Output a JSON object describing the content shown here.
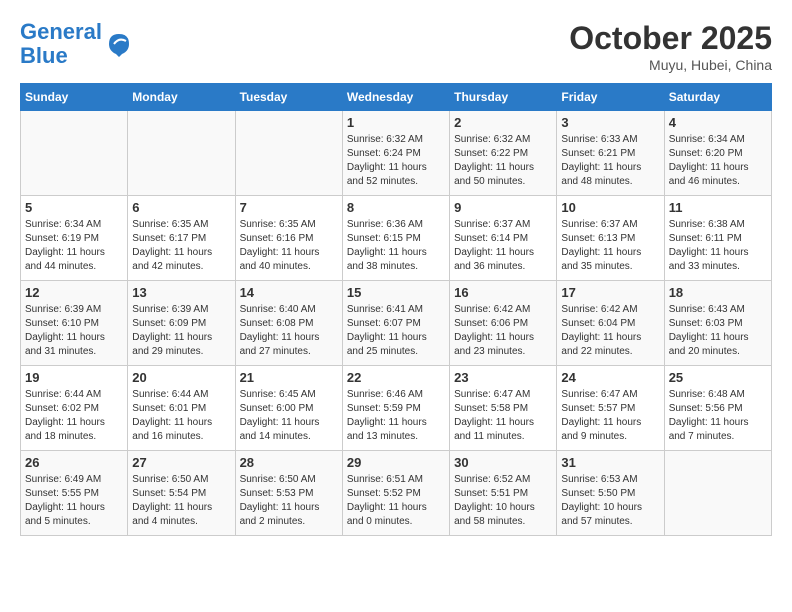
{
  "header": {
    "logo_line1": "General",
    "logo_line2": "Blue",
    "month": "October 2025",
    "location": "Muyu, Hubei, China"
  },
  "days_of_week": [
    "Sunday",
    "Monday",
    "Tuesday",
    "Wednesday",
    "Thursday",
    "Friday",
    "Saturday"
  ],
  "weeks": [
    [
      {
        "day": "",
        "info": ""
      },
      {
        "day": "",
        "info": ""
      },
      {
        "day": "",
        "info": ""
      },
      {
        "day": "1",
        "info": "Sunrise: 6:32 AM\nSunset: 6:24 PM\nDaylight: 11 hours\nand 52 minutes."
      },
      {
        "day": "2",
        "info": "Sunrise: 6:32 AM\nSunset: 6:22 PM\nDaylight: 11 hours\nand 50 minutes."
      },
      {
        "day": "3",
        "info": "Sunrise: 6:33 AM\nSunset: 6:21 PM\nDaylight: 11 hours\nand 48 minutes."
      },
      {
        "day": "4",
        "info": "Sunrise: 6:34 AM\nSunset: 6:20 PM\nDaylight: 11 hours\nand 46 minutes."
      }
    ],
    [
      {
        "day": "5",
        "info": "Sunrise: 6:34 AM\nSunset: 6:19 PM\nDaylight: 11 hours\nand 44 minutes."
      },
      {
        "day": "6",
        "info": "Sunrise: 6:35 AM\nSunset: 6:17 PM\nDaylight: 11 hours\nand 42 minutes."
      },
      {
        "day": "7",
        "info": "Sunrise: 6:35 AM\nSunset: 6:16 PM\nDaylight: 11 hours\nand 40 minutes."
      },
      {
        "day": "8",
        "info": "Sunrise: 6:36 AM\nSunset: 6:15 PM\nDaylight: 11 hours\nand 38 minutes."
      },
      {
        "day": "9",
        "info": "Sunrise: 6:37 AM\nSunset: 6:14 PM\nDaylight: 11 hours\nand 36 minutes."
      },
      {
        "day": "10",
        "info": "Sunrise: 6:37 AM\nSunset: 6:13 PM\nDaylight: 11 hours\nand 35 minutes."
      },
      {
        "day": "11",
        "info": "Sunrise: 6:38 AM\nSunset: 6:11 PM\nDaylight: 11 hours\nand 33 minutes."
      }
    ],
    [
      {
        "day": "12",
        "info": "Sunrise: 6:39 AM\nSunset: 6:10 PM\nDaylight: 11 hours\nand 31 minutes."
      },
      {
        "day": "13",
        "info": "Sunrise: 6:39 AM\nSunset: 6:09 PM\nDaylight: 11 hours\nand 29 minutes."
      },
      {
        "day": "14",
        "info": "Sunrise: 6:40 AM\nSunset: 6:08 PM\nDaylight: 11 hours\nand 27 minutes."
      },
      {
        "day": "15",
        "info": "Sunrise: 6:41 AM\nSunset: 6:07 PM\nDaylight: 11 hours\nand 25 minutes."
      },
      {
        "day": "16",
        "info": "Sunrise: 6:42 AM\nSunset: 6:06 PM\nDaylight: 11 hours\nand 23 minutes."
      },
      {
        "day": "17",
        "info": "Sunrise: 6:42 AM\nSunset: 6:04 PM\nDaylight: 11 hours\nand 22 minutes."
      },
      {
        "day": "18",
        "info": "Sunrise: 6:43 AM\nSunset: 6:03 PM\nDaylight: 11 hours\nand 20 minutes."
      }
    ],
    [
      {
        "day": "19",
        "info": "Sunrise: 6:44 AM\nSunset: 6:02 PM\nDaylight: 11 hours\nand 18 minutes."
      },
      {
        "day": "20",
        "info": "Sunrise: 6:44 AM\nSunset: 6:01 PM\nDaylight: 11 hours\nand 16 minutes."
      },
      {
        "day": "21",
        "info": "Sunrise: 6:45 AM\nSunset: 6:00 PM\nDaylight: 11 hours\nand 14 minutes."
      },
      {
        "day": "22",
        "info": "Sunrise: 6:46 AM\nSunset: 5:59 PM\nDaylight: 11 hours\nand 13 minutes."
      },
      {
        "day": "23",
        "info": "Sunrise: 6:47 AM\nSunset: 5:58 PM\nDaylight: 11 hours\nand 11 minutes."
      },
      {
        "day": "24",
        "info": "Sunrise: 6:47 AM\nSunset: 5:57 PM\nDaylight: 11 hours\nand 9 minutes."
      },
      {
        "day": "25",
        "info": "Sunrise: 6:48 AM\nSunset: 5:56 PM\nDaylight: 11 hours\nand 7 minutes."
      }
    ],
    [
      {
        "day": "26",
        "info": "Sunrise: 6:49 AM\nSunset: 5:55 PM\nDaylight: 11 hours\nand 5 minutes."
      },
      {
        "day": "27",
        "info": "Sunrise: 6:50 AM\nSunset: 5:54 PM\nDaylight: 11 hours\nand 4 minutes."
      },
      {
        "day": "28",
        "info": "Sunrise: 6:50 AM\nSunset: 5:53 PM\nDaylight: 11 hours\nand 2 minutes."
      },
      {
        "day": "29",
        "info": "Sunrise: 6:51 AM\nSunset: 5:52 PM\nDaylight: 11 hours\nand 0 minutes."
      },
      {
        "day": "30",
        "info": "Sunrise: 6:52 AM\nSunset: 5:51 PM\nDaylight: 10 hours\nand 58 minutes."
      },
      {
        "day": "31",
        "info": "Sunrise: 6:53 AM\nSunset: 5:50 PM\nDaylight: 10 hours\nand 57 minutes."
      },
      {
        "day": "",
        "info": ""
      }
    ]
  ]
}
